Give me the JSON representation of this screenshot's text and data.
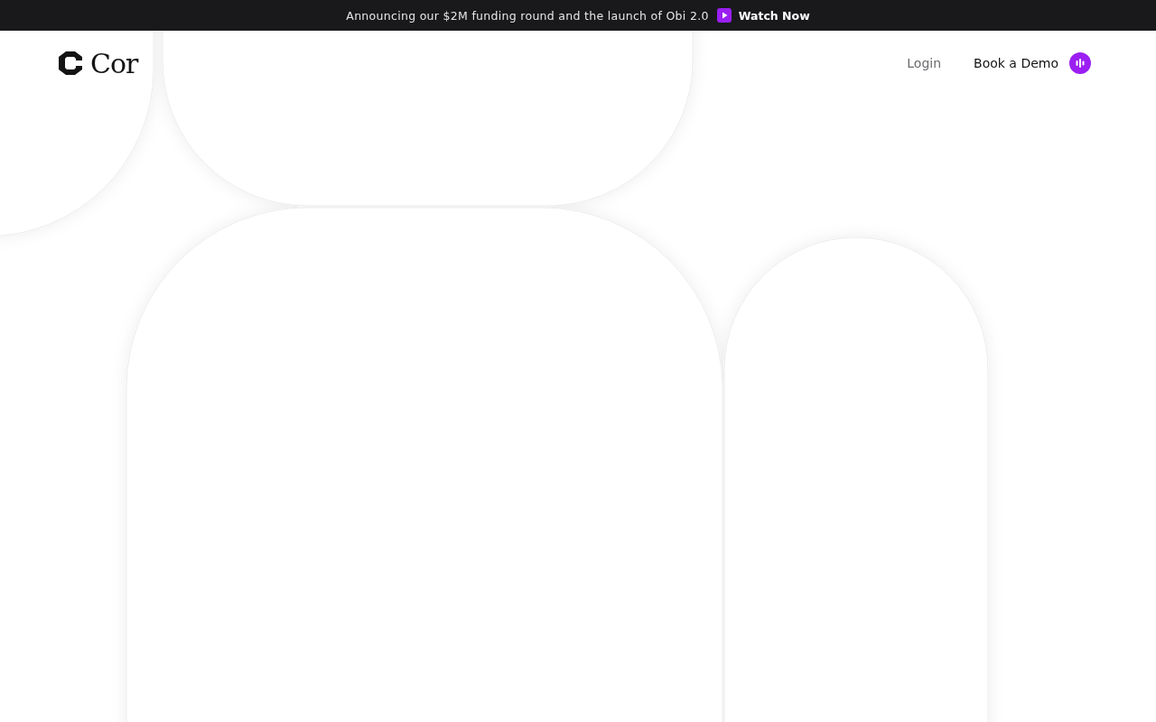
{
  "announcement": {
    "text": "Announcing our $2M funding round and the launch of Obi 2.0",
    "link": "Watch Now"
  },
  "header": {
    "logo": "Cor",
    "nav": [
      {
        "label": "Login",
        "kind": "link"
      },
      {
        "label": "Book a Demo",
        "kind": "cta"
      }
    ]
  }
}
